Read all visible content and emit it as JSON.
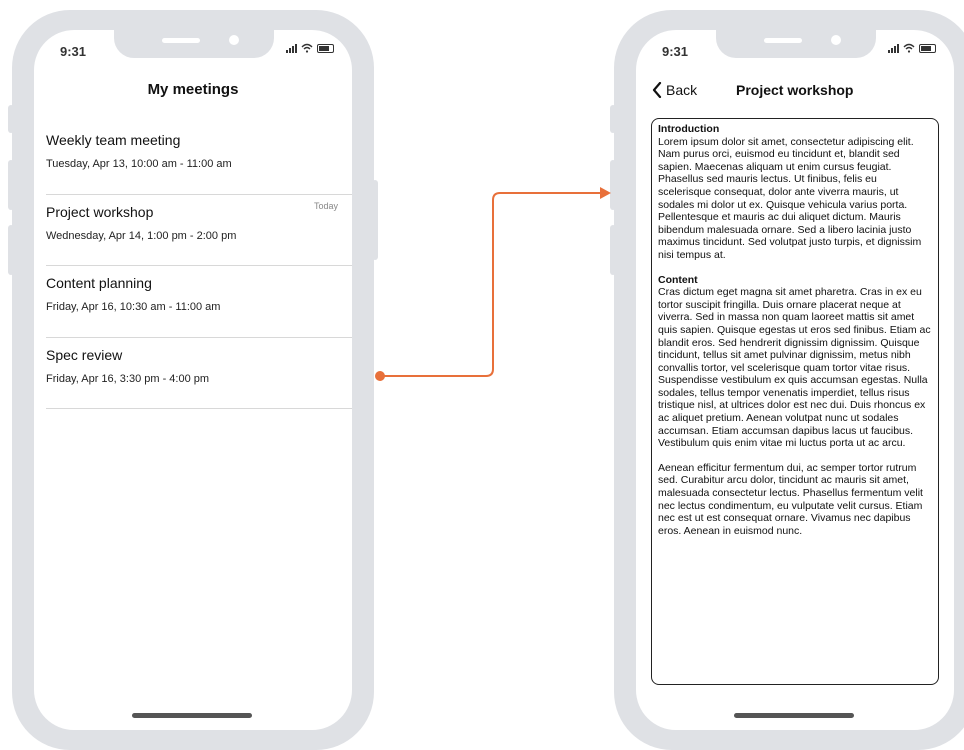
{
  "left_phone": {
    "status_time": "9:31",
    "page_title": "My meetings",
    "meetings": [
      {
        "title": "Weekly team meeting",
        "time": "Tuesday, Apr 13, 10:00 am - 11:00 am",
        "badge": ""
      },
      {
        "title": "Project workshop",
        "time": "Wednesday, Apr 14, 1:00 pm - 2:00 pm",
        "badge": "Today"
      },
      {
        "title": "Content planning",
        "time": "Friday, Apr 16, 10:30 am - 11:00 am",
        "badge": ""
      },
      {
        "title": "Spec review",
        "time": "Friday, Apr 16, 3:30 pm - 4:00 pm",
        "badge": ""
      }
    ]
  },
  "right_phone": {
    "status_time": "9:31",
    "back_label": "Back",
    "title": "Project workshop",
    "sections": [
      {
        "heading": "Introduction",
        "body": "Lorem ipsum dolor sit amet, consectetur adipiscing elit. Nam purus orci, euismod eu tincidunt et, blandit sed sapien. Maecenas aliquam ut enim cursus feugiat. Phasellus sed mauris lectus. Ut finibus, felis eu scelerisque consequat, dolor ante viverra mauris, ut sodales mi dolor ut ex. Quisque vehicula varius porta. Pellentesque et mauris ac dui aliquet dictum. Mauris bibendum malesuada ornare. Sed a libero lacinia justo maximus tincidunt. Sed volutpat justo turpis, et dignissim nisi tempus at."
      },
      {
        "heading": "Content",
        "body": "Cras dictum eget magna sit amet pharetra. Cras in ex eu tortor suscipit fringilla. Duis ornare placerat neque at viverra. Sed in massa non quam laoreet mattis sit amet quis sapien. Quisque egestas ut eros sed finibus. Etiam ac blandit eros. Sed hendrerit dignissim dignissim. Quisque tincidunt, tellus sit amet pulvinar dignissim, metus nibh convallis tortor, vel scelerisque quam tortor vitae risus. Suspendisse vestibulum ex quis accumsan egestas. Nulla sodales, tellus tempor venenatis imperdiet, tellus risus tristique nisl, at ultrices dolor est nec dui. Duis rhoncus ex ac aliquet pretium. Aenean volutpat nunc ut sodales accumsan. Etiam accumsan dapibus lacus ut faucibus. Vestibulum quis enim vitae mi luctus porta ut ac arcu."
      },
      {
        "heading": "",
        "body": "Aenean efficitur fermentum dui, ac semper tortor rutrum sed. Curabitur arcu dolor, tincidunt ac mauris sit amet, malesuada consectetur lectus. Phasellus fermentum velit nec lectus condimentum, eu vulputate velit cursus. Etiam nec est ut est consequat ornare. Vivamus nec dapibus eros. Aenean in euismod nunc."
      }
    ]
  },
  "colors": {
    "connector": "#e8703a",
    "frame": "#dfe1e5"
  },
  "icons": {
    "back": "chevron-left-icon",
    "signal": "signal-icon",
    "wifi": "wifi-icon",
    "battery": "battery-icon"
  }
}
